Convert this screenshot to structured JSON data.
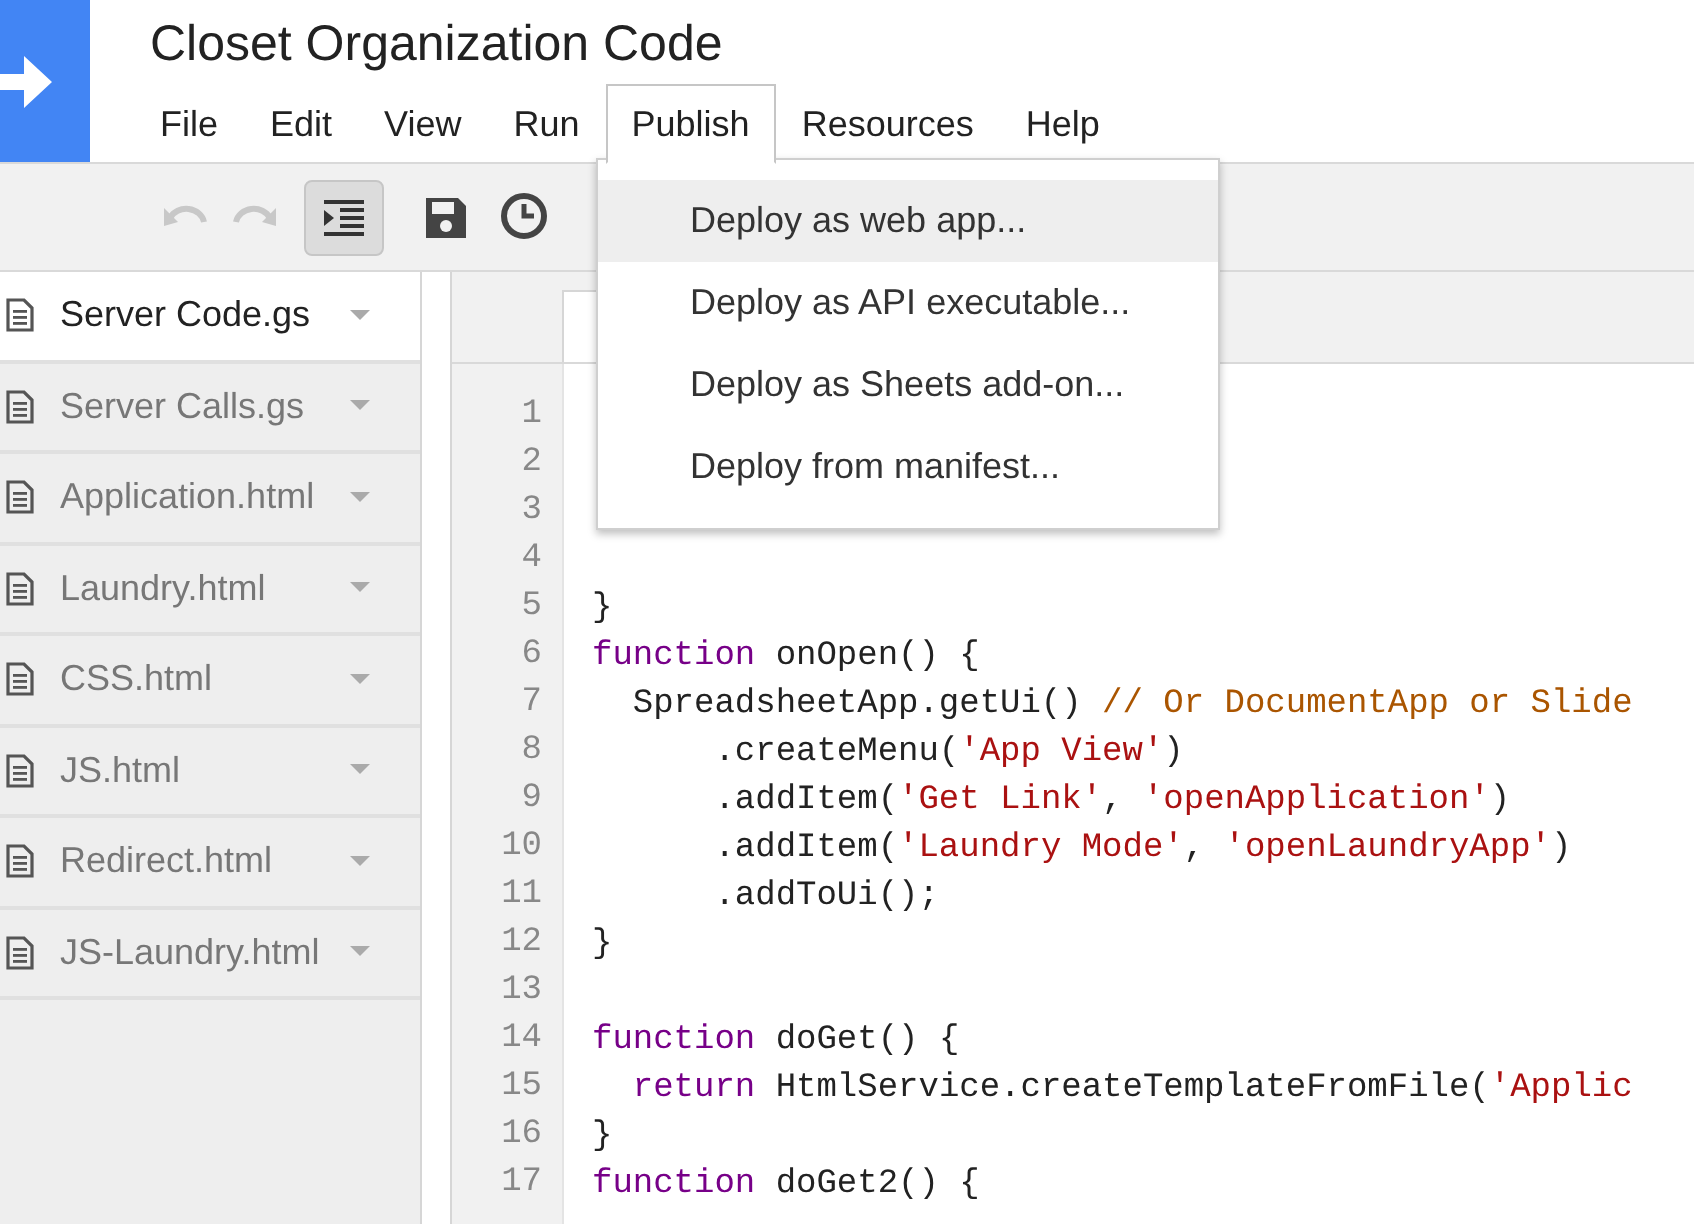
{
  "window": {
    "title": "Closet Organization Code"
  },
  "menu_bar": [
    {
      "label": "File",
      "selected": false
    },
    {
      "label": "Edit",
      "selected": false
    },
    {
      "label": "View",
      "selected": false
    },
    {
      "label": "Run",
      "selected": false
    },
    {
      "label": "Publish",
      "selected": true
    },
    {
      "label": "Resources",
      "selected": false
    },
    {
      "label": "Help",
      "selected": false
    }
  ],
  "toolbar": [
    {
      "kind": "undo",
      "disabled": true
    },
    {
      "kind": "redo",
      "disabled": true
    },
    {
      "kind": "indent",
      "on": true
    },
    {
      "kind": "save",
      "disabled": false
    },
    {
      "kind": "clock",
      "disabled": false
    }
  ],
  "files": [
    {
      "name": "Server Code.gs",
      "selected": true
    },
    {
      "name": "Server Calls.gs",
      "selected": false
    },
    {
      "name": "Application.html",
      "selected": false
    },
    {
      "name": "Laundry.html",
      "selected": false
    },
    {
      "name": "CSS.html",
      "selected": false
    },
    {
      "name": "JS.html",
      "selected": false
    },
    {
      "name": "Redirect.html",
      "selected": false
    },
    {
      "name": "JS-Laundry.html",
      "selected": false
    }
  ],
  "code_lines": [
    {
      "number": "1"
    },
    {
      "number": "2"
    },
    {
      "number": "3"
    },
    {
      "number": "4"
    },
    {
      "number": "5",
      "tokens": [
        {
          "kind": "plain",
          "text": "}"
        }
      ]
    },
    {
      "number": "6",
      "tokens": [
        {
          "kind": "keyword",
          "text": "function"
        },
        {
          "kind": "plain",
          "text": " onOpen() {"
        }
      ]
    },
    {
      "number": "7",
      "tokens": [
        {
          "kind": "plain",
          "text": "  SpreadsheetApp.getUi() "
        },
        {
          "kind": "comment",
          "text": "// Or DocumentApp or Slide"
        }
      ]
    },
    {
      "number": "8",
      "tokens": [
        {
          "kind": "plain",
          "text": "      .createMenu("
        },
        {
          "kind": "string",
          "text": "'App View'"
        },
        {
          "kind": "plain",
          "text": ")"
        }
      ]
    },
    {
      "number": "9",
      "tokens": [
        {
          "kind": "plain",
          "text": "      .addItem("
        },
        {
          "kind": "string",
          "text": "'Get Link'"
        },
        {
          "kind": "plain",
          "text": ", "
        },
        {
          "kind": "string",
          "text": "'openApplication'"
        },
        {
          "kind": "plain",
          "text": ")"
        }
      ]
    },
    {
      "number": "10",
      "tokens": [
        {
          "kind": "plain",
          "text": "      .addItem("
        },
        {
          "kind": "string",
          "text": "'Laundry Mode'"
        },
        {
          "kind": "plain",
          "text": ", "
        },
        {
          "kind": "string",
          "text": "'openLaundryApp'"
        },
        {
          "kind": "plain",
          "text": ")"
        }
      ]
    },
    {
      "number": "11",
      "tokens": [
        {
          "kind": "plain",
          "text": "      .addToUi();"
        }
      ]
    },
    {
      "number": "12",
      "tokens": [
        {
          "kind": "plain",
          "text": "}"
        }
      ]
    },
    {
      "number": "13"
    },
    {
      "number": "14",
      "tokens": [
        {
          "kind": "keyword",
          "text": "function"
        },
        {
          "kind": "plain",
          "text": " doGet() {"
        }
      ]
    },
    {
      "number": "15",
      "tokens": [
        {
          "kind": "keyword",
          "text": "  return"
        },
        {
          "kind": "plain",
          "text": " HtmlService.createTemplateFromFile("
        },
        {
          "kind": "string",
          "text": "'Applic"
        }
      ]
    },
    {
      "number": "16",
      "tokens": [
        {
          "kind": "plain",
          "text": "}"
        }
      ]
    },
    {
      "number": "17",
      "tokens": [
        {
          "kind": "keyword",
          "text": "function"
        },
        {
          "kind": "plain",
          "text": " doGet2() {"
        }
      ]
    }
  ],
  "publish_menu": [
    {
      "label": "Deploy as web app...",
      "selected": true
    },
    {
      "label": "Deploy as API executable...",
      "selected": false
    },
    {
      "label": "Deploy as Sheets add-on...",
      "selected": false
    },
    {
      "label": "Deploy from manifest...",
      "selected": false
    }
  ]
}
